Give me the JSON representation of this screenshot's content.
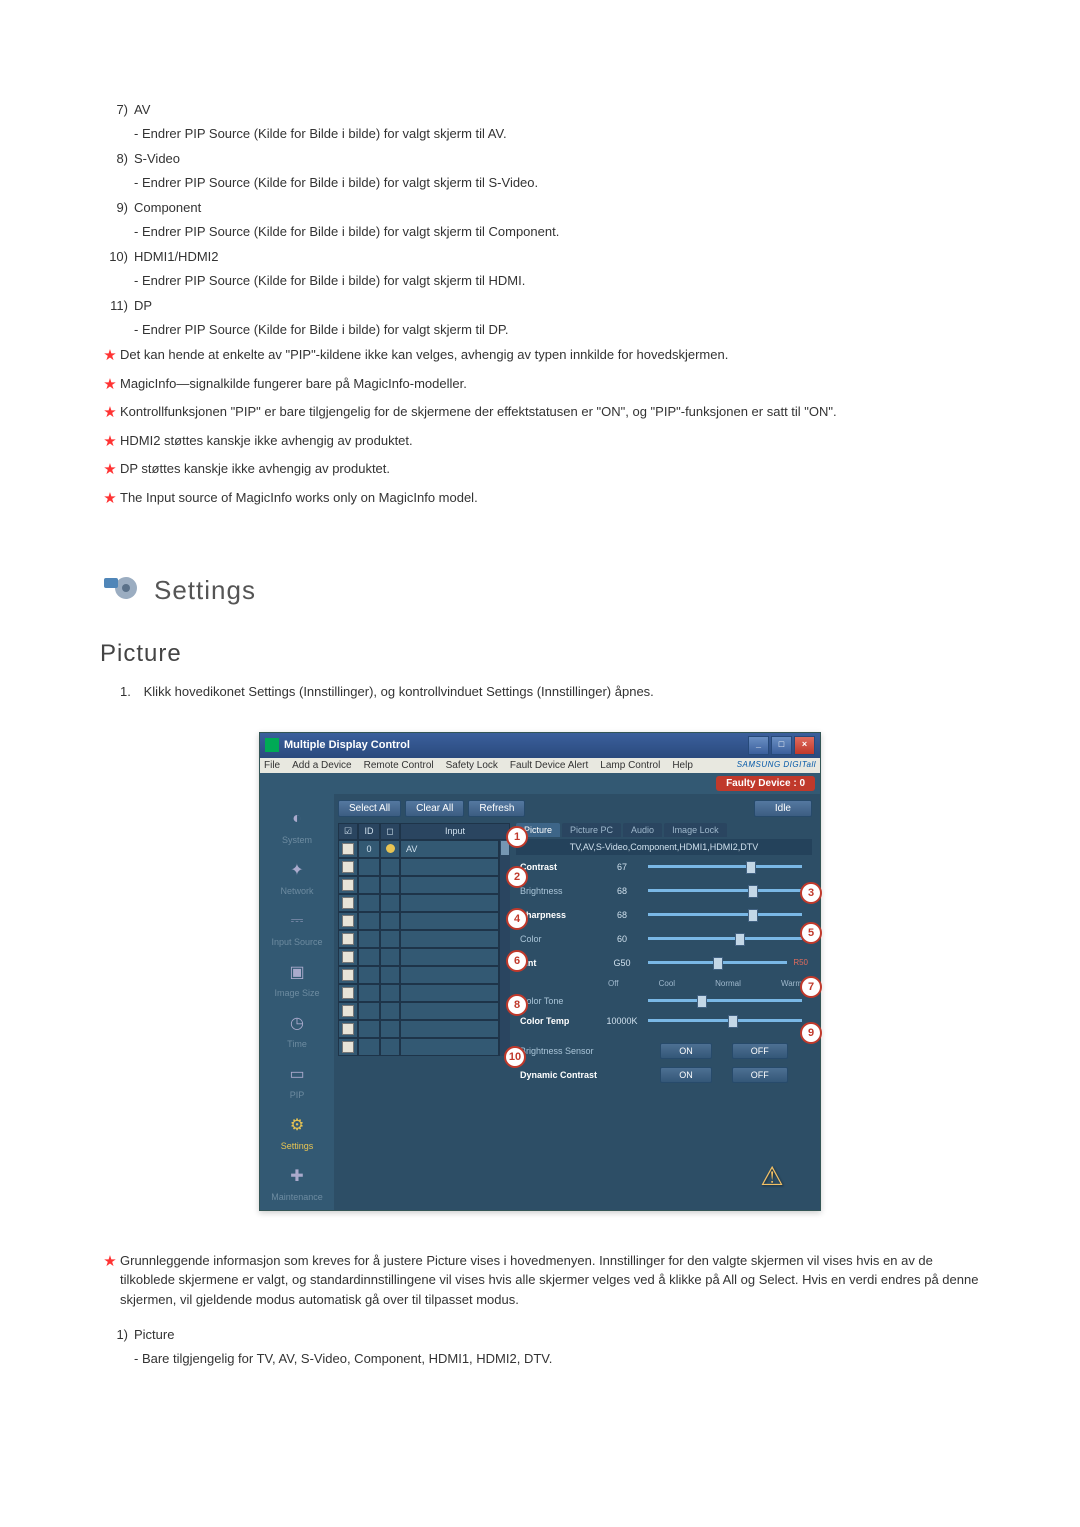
{
  "list": [
    {
      "num": "7)",
      "label": "AV",
      "sub": "- Endrer PIP Source (Kilde for Bilde i bilde) for valgt skjerm til AV."
    },
    {
      "num": "8)",
      "label": "S-Video",
      "sub": "- Endrer PIP Source (Kilde for Bilde i bilde) for valgt skjerm til S-Video."
    },
    {
      "num": "9)",
      "label": "Component",
      "sub": "- Endrer PIP Source (Kilde for Bilde i bilde) for valgt skjerm til Component."
    },
    {
      "num": "10)",
      "label": "HDMI1/HDMI2",
      "sub": "- Endrer PIP Source (Kilde for Bilde i bilde) for valgt skjerm til HDMI."
    },
    {
      "num": "11)",
      "label": "DP",
      "sub": "- Endrer PIP Source (Kilde for Bilde i bilde) for valgt skjerm til DP."
    }
  ],
  "stars_top": [
    "Det kan hende at enkelte av \"PIP\"-kildene ikke kan velges, avhengig av typen innkilde for hovedskjermen.",
    "MagicInfo—signalkilde fungerer bare på MagicInfo-modeller.",
    "Kontrollfunksjonen \"PIP\" er bare tilgjengelig for de skjermene der effektstatusen er \"ON\", og \"PIP\"-funksjonen er satt til \"ON\".",
    "HDMI2 støttes kanskje ikke avhengig av produktet.",
    "DP støttes kanskje ikke avhengig av produktet.",
    "The Input source of MagicInfo works only on MagicInfo model."
  ],
  "section": {
    "settings_title": "Settings",
    "picture_title": "Picture",
    "intro_num": "1.",
    "intro_text": "Klikk hovedikonet Settings (Innstillinger), og kontrollvinduet Settings (Innstillinger) åpnes."
  },
  "stars_bottom": [
    "Grunnleggende informasjon som kreves for å justere Picture vises i hovedmenyen. Innstillinger for den valgte skjermen vil vises hvis en av de tilkoblede skjermene er valgt, og standardinnstillingene vil vises hvis alle skjermer velges ved å klikke på All og Select. Hvis en verdi endres på denne skjermen, vil gjeldende modus automatisk gå over til tilpasset modus."
  ],
  "bottom_item": {
    "num": "1)",
    "label": "Picture",
    "sub": "- Bare tilgjengelig for TV, AV, S-Video, Component, HDMI1, HDMI2, DTV."
  },
  "app": {
    "title": "Multiple Display Control",
    "menu": [
      "File",
      "Add a Device",
      "Remote Control",
      "Safety Lock",
      "Fault Device Alert",
      "Lamp Control",
      "Help"
    ],
    "brand": "SAMSUNG DIGITall",
    "faulty": "Faulty Device : 0",
    "toolbar": {
      "select_all": "Select All",
      "clear_all": "Clear All",
      "refresh": "Refresh",
      "idle": "Idle"
    },
    "sidebar": [
      "System",
      "Network",
      "Input Source",
      "Image Size",
      "Time",
      "PIP",
      "Settings",
      "Maintenance"
    ],
    "grid_headers": {
      "id": "ID",
      "input": "Input"
    },
    "grid_row": {
      "id": "0",
      "input": "AV"
    },
    "tabs": [
      "Picture",
      "Picture PC",
      "Audio",
      "Image Lock"
    ],
    "tab_info": "TV,AV,S-Video,Component,HDMI1,HDMI2,DTV",
    "controls": {
      "contrast": {
        "label": "Contrast",
        "value": "67",
        "pos": 67
      },
      "brightness": {
        "label": "Brightness",
        "value": "68",
        "pos": 68
      },
      "sharpness": {
        "label": "Sharpness",
        "value": "68",
        "pos": 68
      },
      "color": {
        "label": "Color",
        "value": "60",
        "pos": 60
      },
      "tint": {
        "label": "Tint",
        "value": "G50",
        "right": "R50",
        "pos": 50
      },
      "color_tone": {
        "label": "Color Tone",
        "opts": [
          "Off",
          "Cool",
          "Normal",
          "Warm"
        ],
        "pos": 35
      },
      "color_temp": {
        "label": "Color Temp",
        "value": "10000K",
        "pos": 55
      },
      "bright_sensor": {
        "label": "Brightness Sensor",
        "on": "ON",
        "off": "OFF"
      },
      "dynamic": {
        "label": "Dynamic Contrast",
        "on": "ON",
        "off": "OFF"
      }
    }
  }
}
